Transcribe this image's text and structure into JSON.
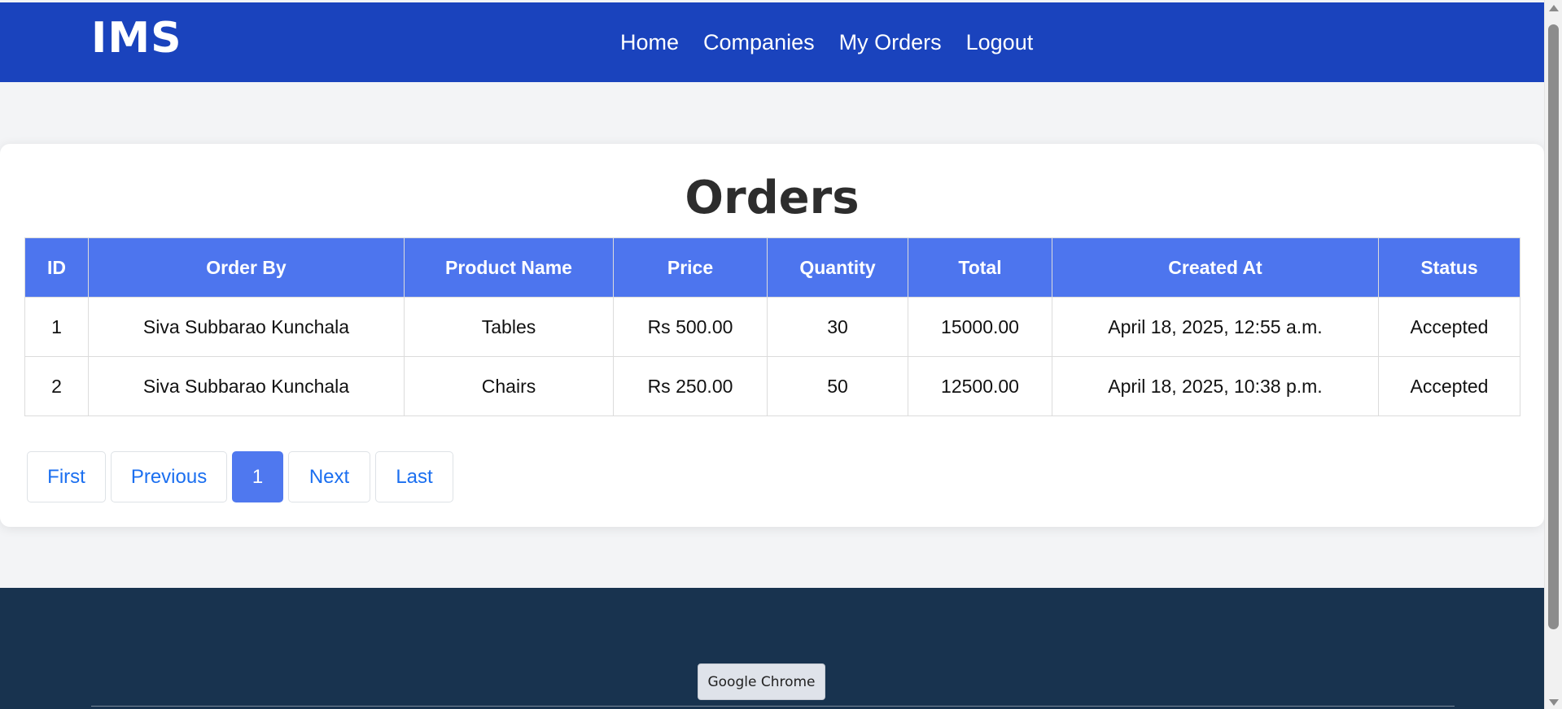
{
  "brand": "IMS",
  "nav": [
    "Home",
    "Companies",
    "My Orders",
    "Logout"
  ],
  "page_title": "Orders",
  "table": {
    "headers": [
      "ID",
      "Order By",
      "Product Name",
      "Price",
      "Quantity",
      "Total",
      "Created At",
      "Status"
    ],
    "rows": [
      [
        "1",
        "Siva Subbarao Kunchala",
        "Tables",
        "Rs 500.00",
        "30",
        "15000.00",
        "April 18, 2025, 12:55 a.m.",
        "Accepted"
      ],
      [
        "2",
        "Siva Subbarao Kunchala",
        "Chairs",
        "Rs 250.00",
        "50",
        "12500.00",
        "April 18, 2025, 10:38 p.m.",
        "Accepted"
      ]
    ]
  },
  "pagination": {
    "first": "First",
    "previous": "Previous",
    "current": "1",
    "next": "Next",
    "last": "Last"
  },
  "tooltip": "Google Chrome",
  "colors": {
    "header_bg": "#1a43bd",
    "table_header_bg": "#4d75ee",
    "link": "#1b6ff0",
    "footer_bg": "#18334f"
  }
}
